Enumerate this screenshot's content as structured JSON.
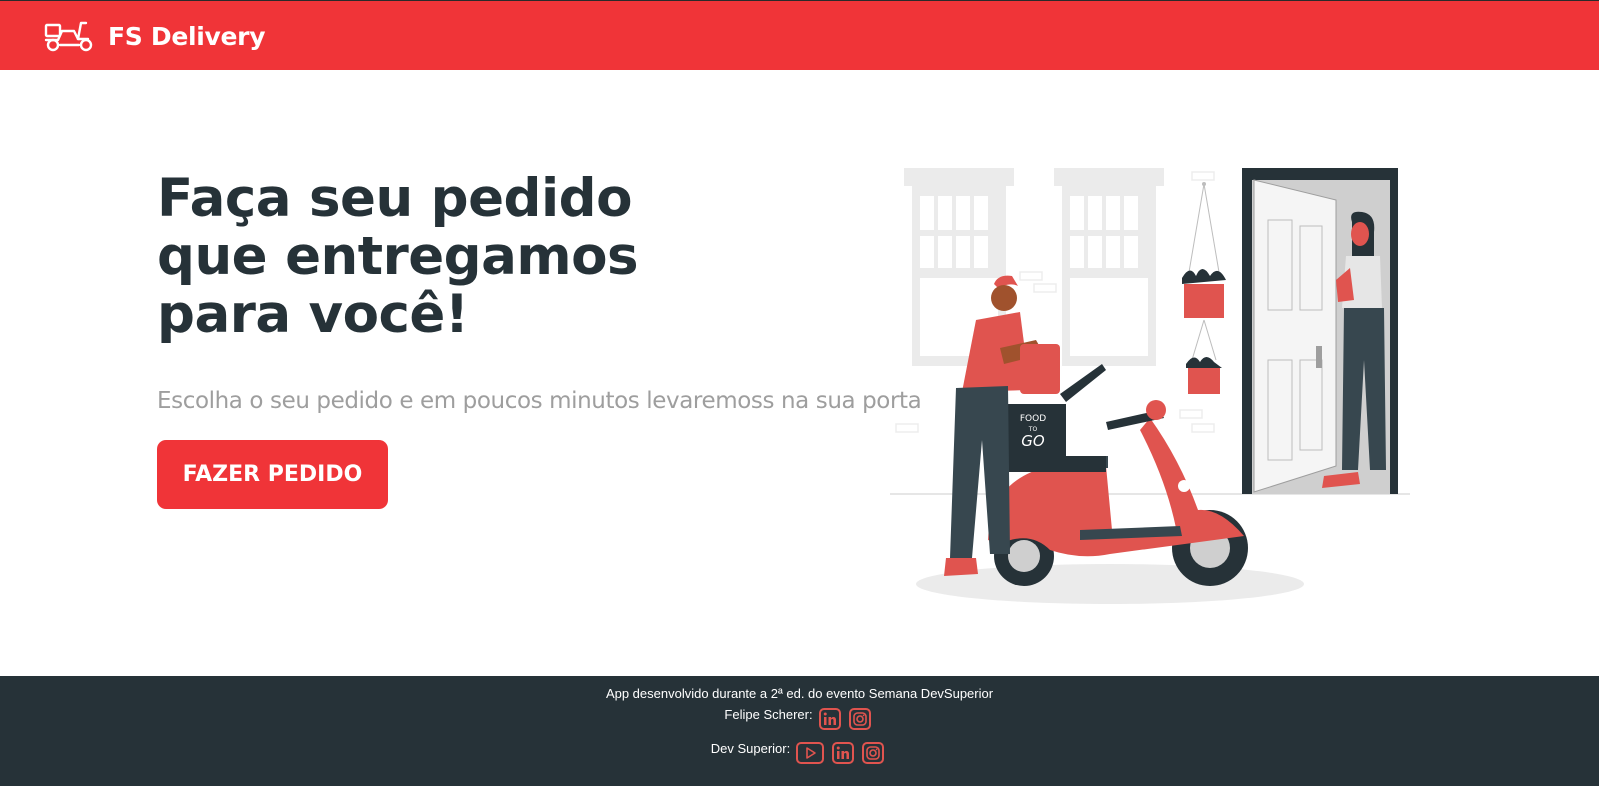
{
  "header": {
    "brand_name": "FS Delivery",
    "logo_icon": "scooter-icon",
    "background_color": "#f03438"
  },
  "hero": {
    "title": "Faça seu pedido que entregamos para você!",
    "subtitle": "Escolha o seu pedido e em poucos minutos levaremoss na sua porta",
    "cta_label": "FAZER PEDIDO",
    "illustration_box_text": [
      "FOOD",
      "TO",
      "GO"
    ],
    "accent_color": "#f03438",
    "text_color": "#263238"
  },
  "footer": {
    "credit": "App desenvolvido durante a 2ª ed. do evento Semana DevSuperior",
    "author_label": "Felipe Scherer:",
    "org_label": "Dev Superior:",
    "author_icons": [
      "linkedin-icon",
      "instagram-icon"
    ],
    "org_icons": [
      "youtube-icon",
      "linkedin-icon",
      "instagram-icon"
    ],
    "background_color": "#263238",
    "icon_color": "#e0544f"
  }
}
